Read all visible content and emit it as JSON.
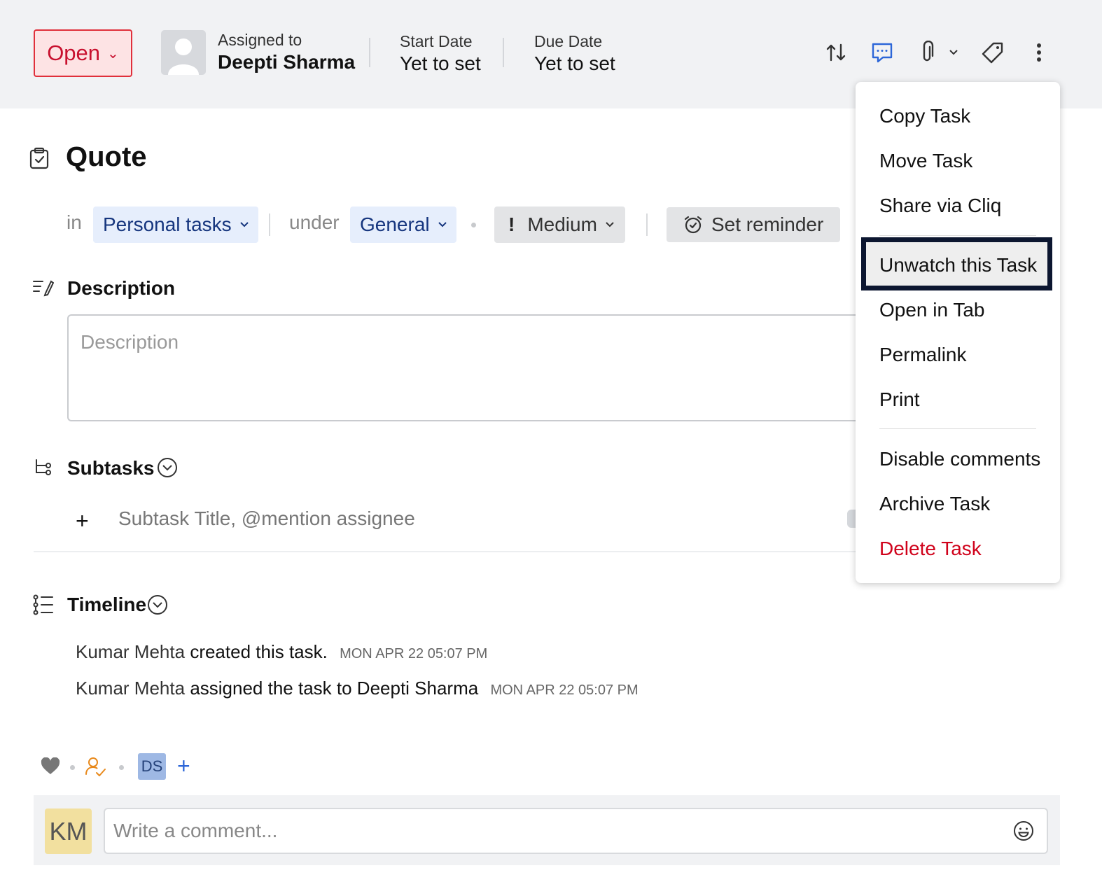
{
  "header": {
    "status": "Open",
    "assigned_label": "Assigned to",
    "assignee": "Deepti Sharma",
    "start_label": "Start Date",
    "start_value": "Yet to set",
    "due_label": "Due Date",
    "due_value": "Yet to set",
    "icons": [
      "swap-icon",
      "chat-icon",
      "attachment-icon",
      "chevron-down-icon",
      "tag-icon",
      "more-vertical-icon"
    ]
  },
  "task": {
    "title": "Quote",
    "in_label": "in",
    "project": "Personal tasks",
    "under_label": "under",
    "list": "General",
    "priority": "Medium",
    "reminder": "Set reminder"
  },
  "description": {
    "title": "Description",
    "placeholder": "Description"
  },
  "subtasks": {
    "title": "Subtasks",
    "placeholder": "Subtask Title, @mention assignee"
  },
  "timeline": {
    "title": "Timeline",
    "entries": [
      {
        "user": "Kumar Mehta",
        "action": "created this task.",
        "time": "MON APR 22 05:07 PM"
      },
      {
        "user": "Kumar Mehta",
        "action": "assigned the task to Deepti Sharma",
        "time": "MON APR 22 05:07 PM"
      }
    ]
  },
  "footer": {
    "follower_initials": "DS",
    "add": "+",
    "commenter_initials": "KM",
    "comment_placeholder": "Write a comment..."
  },
  "menu": {
    "items": [
      {
        "label": "Copy Task"
      },
      {
        "label": "Move Task"
      },
      {
        "label": "Share via Cliq"
      },
      {
        "label": "Unwatch this Task"
      },
      {
        "label": "Open in Tab"
      },
      {
        "label": "Permalink"
      },
      {
        "label": "Print"
      },
      {
        "label": "Disable comments"
      },
      {
        "label": "Archive Task"
      },
      {
        "label": "Delete Task"
      }
    ],
    "highlighted": "Unwatch this Task",
    "danger_color": "#d0021b"
  },
  "colors": {
    "status_red": "#c8102e",
    "chip_blue_text": "#15357e",
    "accent_blue": "#2c66d8"
  }
}
